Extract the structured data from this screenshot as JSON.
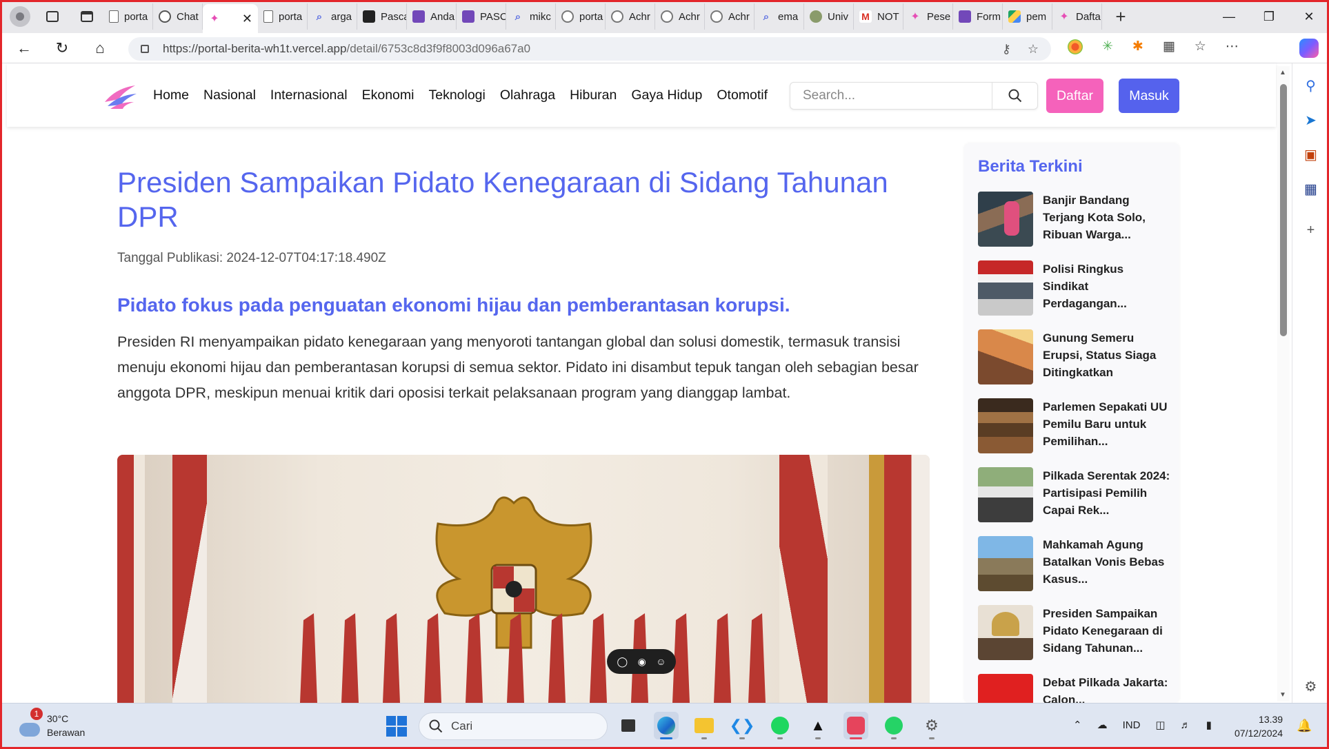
{
  "browser": {
    "tabs": [
      {
        "label": "porta",
        "icon": "doc-icon"
      },
      {
        "label": "Chat",
        "icon": "chatgpt-icon"
      },
      {
        "label": "",
        "icon": "portal-logo-icon",
        "active": true
      },
      {
        "label": "porta",
        "icon": "doc-icon"
      },
      {
        "label": "arga",
        "icon": "search-icon"
      },
      {
        "label": "Pasca",
        "icon": "id-card-icon"
      },
      {
        "label": "Anda",
        "icon": "form-icon"
      },
      {
        "label": "PASC",
        "icon": "form-icon"
      },
      {
        "label": "mikc",
        "icon": "search-icon"
      },
      {
        "label": "porta",
        "icon": "github-icon"
      },
      {
        "label": "Achr",
        "icon": "github-icon"
      },
      {
        "label": "Achr",
        "icon": "github-icon"
      },
      {
        "label": "Achr",
        "icon": "github-icon"
      },
      {
        "label": "ema",
        "icon": "search-icon"
      },
      {
        "label": "Univ",
        "icon": "globe-icon"
      },
      {
        "label": "NOT",
        "icon": "gmail-icon"
      },
      {
        "label": "Pese",
        "icon": "portal-logo-icon"
      },
      {
        "label": "Form",
        "icon": "form-icon"
      },
      {
        "label": "pem",
        "icon": "drive-icon"
      },
      {
        "label": "Dafta",
        "icon": "portal-logo-icon"
      }
    ],
    "url_host": "https://portal-berita-wh1t.vercel.app",
    "url_path": "/detail/6753c8d3f9f8003d096a67a0"
  },
  "site": {
    "nav": [
      "Home",
      "Nasional",
      "Internasional",
      "Ekonomi",
      "Teknologi",
      "Olahraga",
      "Hiburan",
      "Gaya Hidup",
      "Otomotif"
    ],
    "search_placeholder": "Search...",
    "register_label": "Daftar",
    "login_label": "Masuk",
    "accent_color": "#5566ee",
    "pink_color": "#f562bb"
  },
  "article": {
    "title": "Presiden Sampaikan Pidato Kenegaraan di Sidang Tahunan DPR",
    "published": "Tanggal Publikasi: 2024-12-07T04:17:18.490Z",
    "lead": "Pidato fokus pada penguatan ekonomi hijau dan pemberantasan korupsi.",
    "body": "Presiden RI menyampaikan pidato kenegaraan yang menyoroti tantangan global dan solusi domestik, termasuk transisi menuju ekonomi hijau dan pemberantasan korupsi di semua sektor. Pidato ini disambut tepuk tangan oleh sebagian besar anggota DPR, meskipun menuai kritik dari oposisi terkait pelaksanaan program yang dianggap lambat."
  },
  "latest": {
    "heading": "Berita Terkini",
    "items": [
      {
        "title": "Banjir Bandang Terjang Kota Solo, Ribuan Warga..."
      },
      {
        "title": "Polisi Ringkus Sindikat Perdagangan..."
      },
      {
        "title": "Gunung Semeru Erupsi, Status Siaga Ditingkatkan"
      },
      {
        "title": "Parlemen Sepakati UU Pemilu Baru untuk Pemilihan..."
      },
      {
        "title": "Pilkada Serentak 2024: Partisipasi Pemilih Capai Rek..."
      },
      {
        "title": "Mahkamah Agung Batalkan Vonis Bebas Kasus..."
      },
      {
        "title": "Presiden Sampaikan Pidato Kenegaraan di Sidang Tahunan..."
      },
      {
        "title": "Debat Pilkada Jakarta: Calon..."
      }
    ]
  },
  "taskbar": {
    "weather_temp": "30°C",
    "weather_desc": "Berawan",
    "weather_badge": "1",
    "search_label": "Cari",
    "language": "IND",
    "time": "13.39",
    "date": "07/12/2024"
  }
}
